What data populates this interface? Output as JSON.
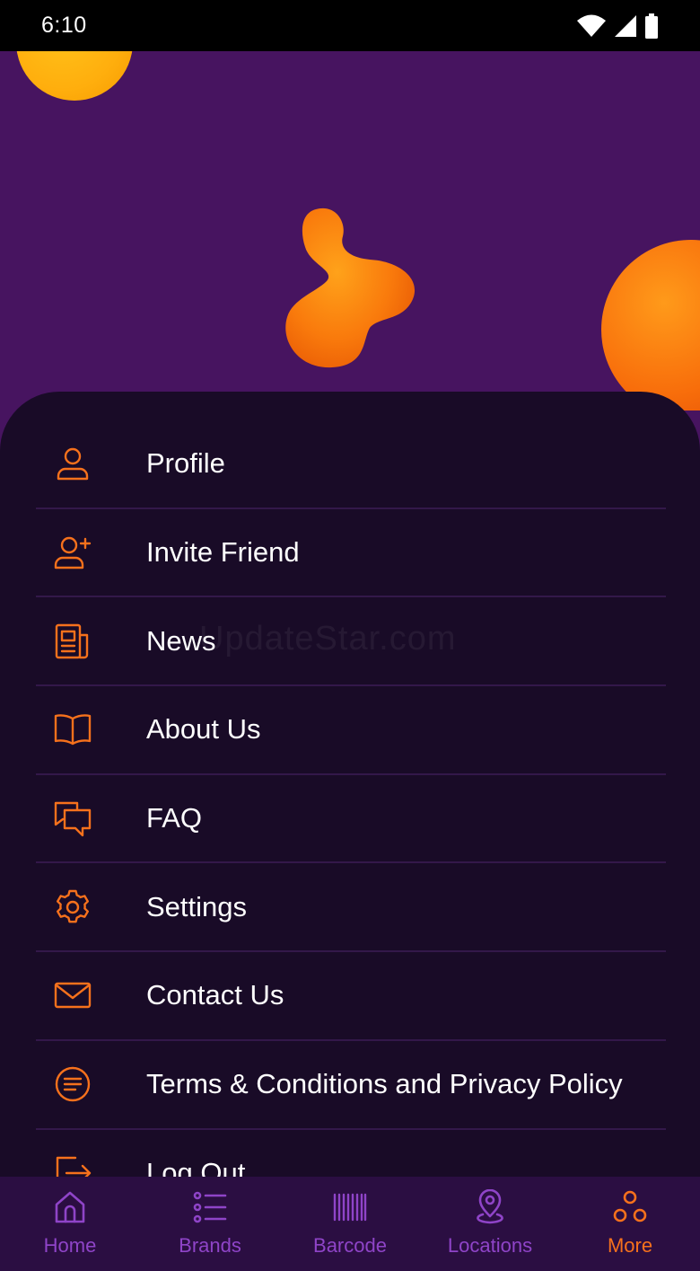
{
  "status_bar": {
    "time": "6:10"
  },
  "watermark": "UpdateStar.com",
  "colors": {
    "accent": "#F6711C",
    "nav_inactive": "#8F44C8",
    "sheet_bg": "#190B27",
    "hero_bg": "#471460"
  },
  "menu": {
    "items": [
      {
        "label": "Profile",
        "icon": "user-icon"
      },
      {
        "label": "Invite Friend",
        "icon": "user-plus-icon"
      },
      {
        "label": "News",
        "icon": "newspaper-icon"
      },
      {
        "label": "About Us",
        "icon": "book-open-icon"
      },
      {
        "label": "FAQ",
        "icon": "chat-bubbles-icon"
      },
      {
        "label": "Settings",
        "icon": "gear-icon"
      },
      {
        "label": "Contact Us",
        "icon": "envelope-icon"
      },
      {
        "label": "Terms & Conditions and Privacy Policy",
        "icon": "document-lines-icon"
      },
      {
        "label": "Log Out",
        "icon": "logout-icon"
      }
    ]
  },
  "bottom_nav": {
    "active": "More",
    "items": [
      {
        "label": "Home",
        "icon": "home-icon"
      },
      {
        "label": "Brands",
        "icon": "list-icon"
      },
      {
        "label": "Barcode",
        "icon": "barcode-icon"
      },
      {
        "label": "Locations",
        "icon": "location-pin-icon"
      },
      {
        "label": "More",
        "icon": "more-circles-icon"
      }
    ]
  }
}
